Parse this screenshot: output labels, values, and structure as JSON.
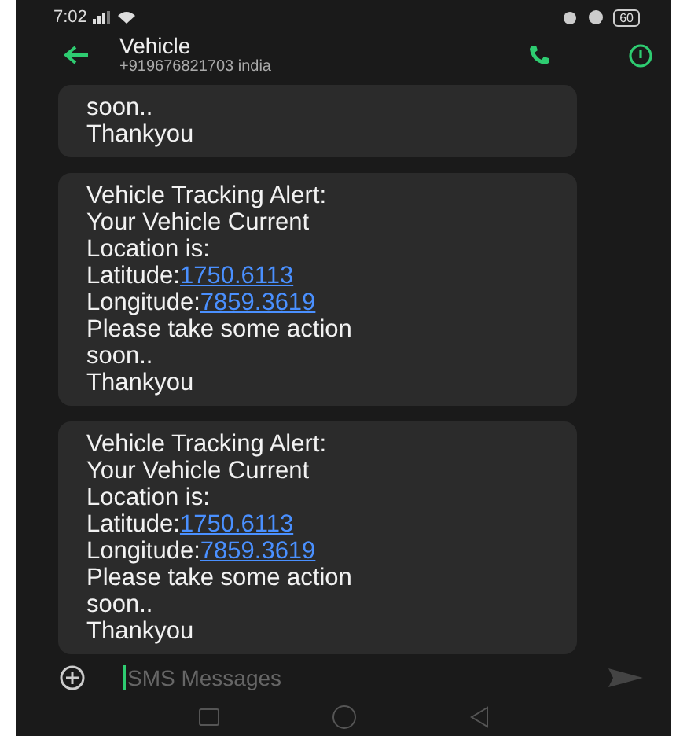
{
  "status_bar": {
    "time": "7:02",
    "battery": "60"
  },
  "header": {
    "title": "Vehicle",
    "subtitle": "+919676821703  india"
  },
  "messages": [
    {
      "lines": [
        {
          "text": "soon.."
        },
        {
          "text": "Thankyou"
        }
      ]
    },
    {
      "lines": [
        {
          "text": "Vehicle Tracking Alert:"
        },
        {
          "text": "Your Vehicle Current"
        },
        {
          "text": "Location is:"
        },
        {
          "text": "Latitude:",
          "link": "1750.6113"
        },
        {
          "text": "Longitude:",
          "link": "7859.3619"
        },
        {
          "text": "Please take some action"
        },
        {
          "text": "soon.."
        },
        {
          "text": "Thankyou"
        }
      ]
    },
    {
      "lines": [
        {
          "text": "Vehicle Tracking Alert:"
        },
        {
          "text": "Your Vehicle Current"
        },
        {
          "text": "Location is:"
        },
        {
          "text": "Latitude:",
          "link": "1750.6113"
        },
        {
          "text": "Longitude:",
          "link": "7859.3619"
        },
        {
          "text": "Please take some action"
        },
        {
          "text": "soon.."
        },
        {
          "text": "Thankyou"
        }
      ]
    }
  ],
  "composer": {
    "placeholder": "SMS Messages"
  }
}
